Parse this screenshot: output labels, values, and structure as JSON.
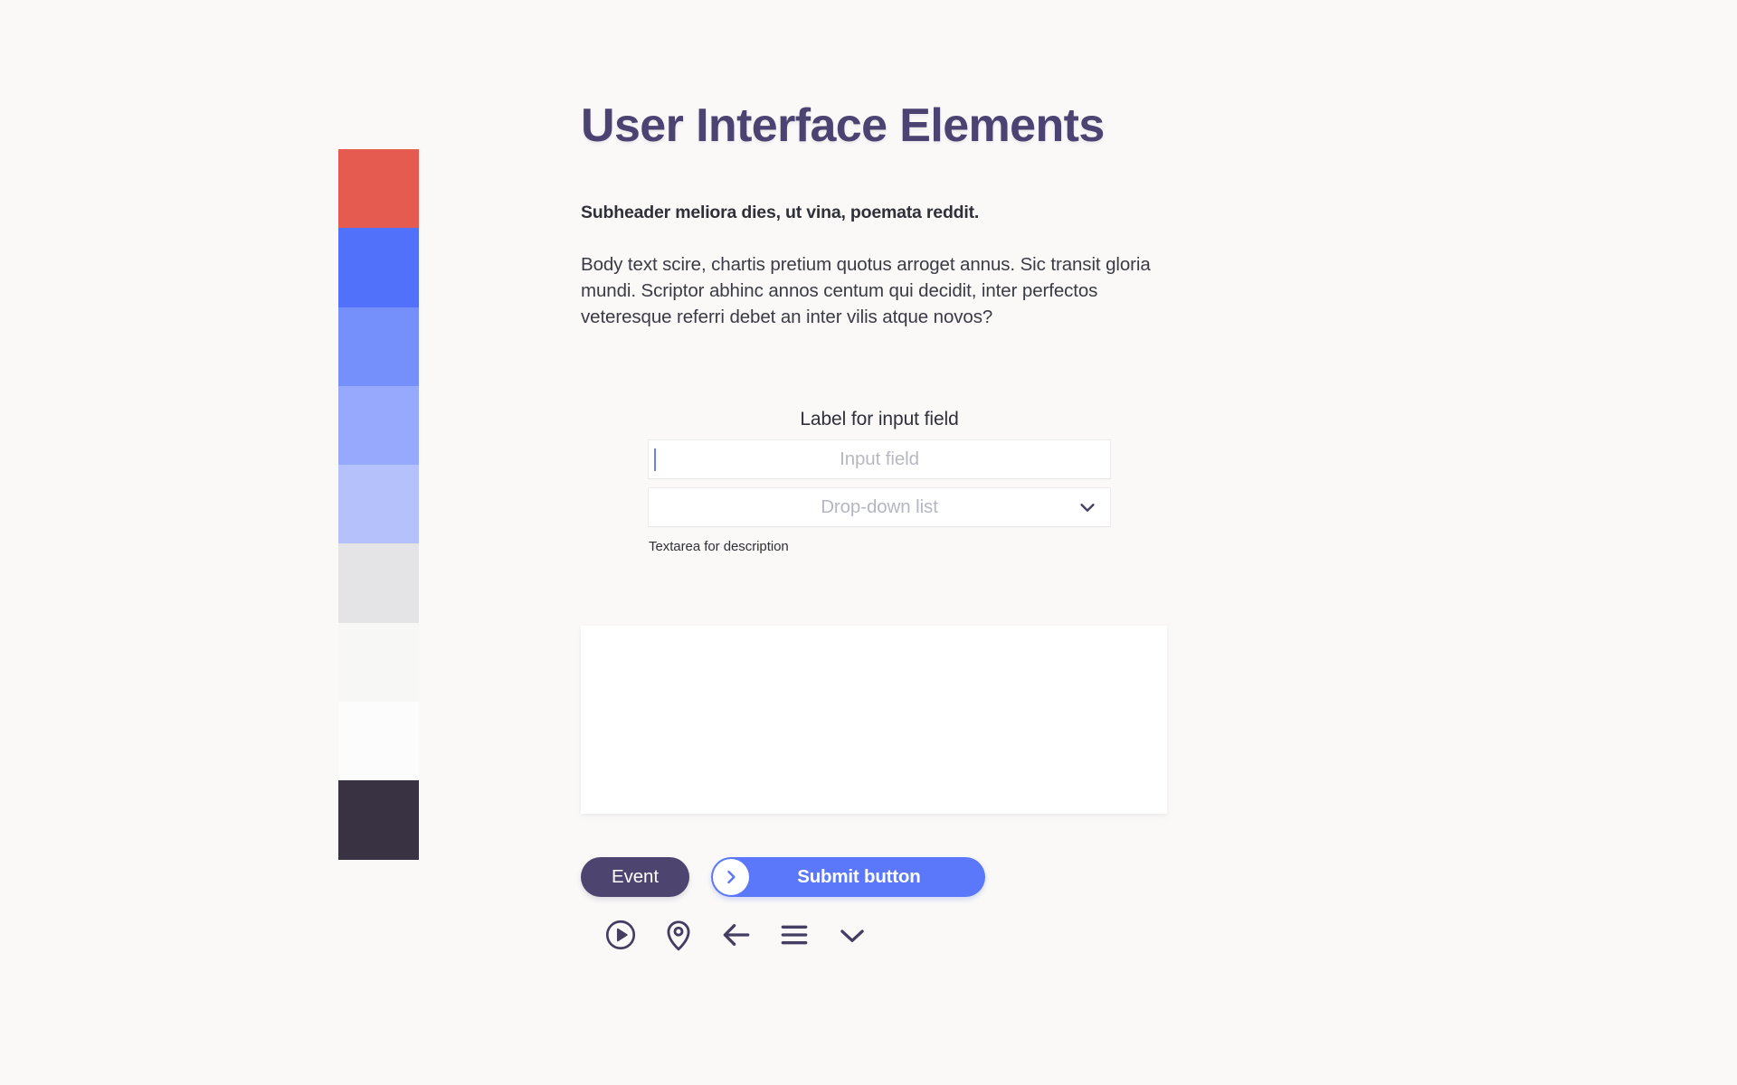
{
  "page": {
    "background_color": "#faf9f8",
    "title": "User Interface Elements",
    "subheader": "Subheader meliora dies, ut vina, poemata reddit.",
    "body_text": "Body text scire, chartis pretium quotus arroget annus. Sic transit gloria mundi. Scriptor abhinc annos centum qui decidit, inter perfectos veteresque referri debet an inter vilis atque novos?"
  },
  "palette": {
    "title_color": "#4b4372",
    "swatches": [
      {
        "name": "red",
        "hex": "#e55b50"
      },
      {
        "name": "blue-600",
        "hex": "#5271fa"
      },
      {
        "name": "blue-500",
        "hex": "#7690fb"
      },
      {
        "name": "blue-400",
        "hex": "#97a9fc"
      },
      {
        "name": "blue-300",
        "hex": "#b5c1fb"
      },
      {
        "name": "gray-200",
        "hex": "#e4e4e6"
      },
      {
        "name": "gray-050",
        "hex": "#f7f7f5"
      },
      {
        "name": "white",
        "hex": "#fcfcfc"
      },
      {
        "name": "navy-900",
        "hex": "#393243"
      }
    ]
  },
  "form": {
    "input_label": "Label for input field",
    "input_placeholder": "Input field",
    "input_value": "",
    "dropdown_placeholder": "Drop-down list",
    "dropdown_value": "",
    "dropdown_icon": "chevron-down-icon",
    "textarea_label": "Textarea for description",
    "textarea_value": "",
    "caret_color": "#6f7ff2"
  },
  "buttons": {
    "event_label": "Event",
    "event_color": "#4e4470",
    "submit_label": "Submit button",
    "submit_color": "#5b77fa",
    "submit_icon": "chevron-right-icon"
  },
  "icons": [
    {
      "name": "play-circle-icon"
    },
    {
      "name": "map-pin-icon"
    },
    {
      "name": "arrow-left-icon"
    },
    {
      "name": "hamburger-menu-icon"
    },
    {
      "name": "chevron-down-icon"
    }
  ]
}
